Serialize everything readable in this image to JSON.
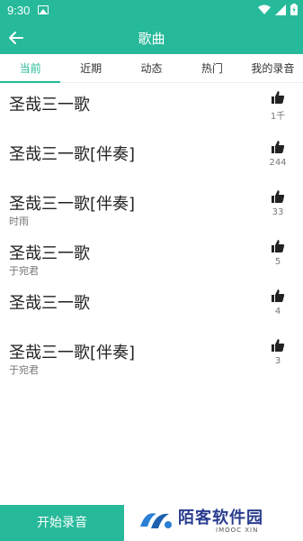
{
  "status_bar": {
    "time": "9:30"
  },
  "app_bar": {
    "title": "歌曲"
  },
  "tabs": [
    {
      "label": "当前",
      "active": true
    },
    {
      "label": "近期",
      "active": false
    },
    {
      "label": "动态",
      "active": false
    },
    {
      "label": "热门",
      "active": false
    },
    {
      "label": "我的录音",
      "active": false
    }
  ],
  "songs": [
    {
      "title": "圣哉三一歌",
      "artist": "",
      "likes": "1千"
    },
    {
      "title": "圣哉三一歌[伴奏]",
      "artist": "",
      "likes": "244"
    },
    {
      "title": "圣哉三一歌[伴奏]",
      "artist": "时雨",
      "likes": "33"
    },
    {
      "title": "圣哉三一歌",
      "artist": "于宛君",
      "likes": "5"
    },
    {
      "title": "圣哉三一歌",
      "artist": "",
      "likes": "4"
    },
    {
      "title": "圣哉三一歌[伴奏]",
      "artist": "于宛君",
      "likes": "3"
    }
  ],
  "record_button": {
    "label": "开始录音"
  },
  "watermark": {
    "text": "陌客软件园",
    "subtext": "IMOOC XIN"
  },
  "colors": {
    "accent": "#26b99a"
  }
}
